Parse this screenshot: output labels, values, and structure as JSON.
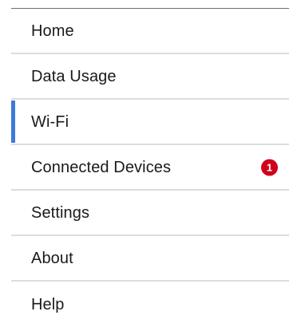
{
  "nav": {
    "items": [
      {
        "label": "Home"
      },
      {
        "label": "Data Usage"
      },
      {
        "label": "Wi-Fi",
        "active": true
      },
      {
        "label": "Connected Devices",
        "badge": "1"
      },
      {
        "label": "Settings"
      },
      {
        "label": "About"
      },
      {
        "label": "Help"
      }
    ]
  },
  "colors": {
    "accent": "#3a7bd5",
    "badge": "#d0021b",
    "divider": "#dcdcdc"
  }
}
